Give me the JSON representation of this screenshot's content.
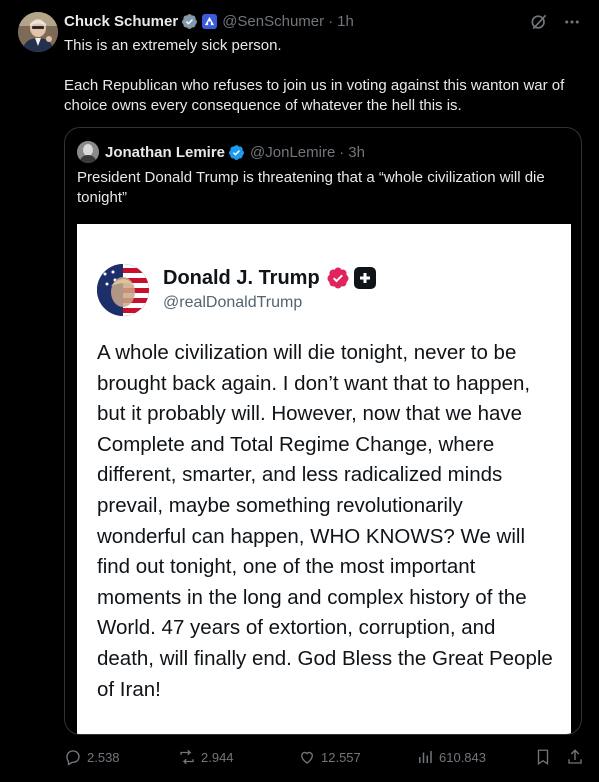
{
  "author": {
    "name": "Chuck Schumer",
    "handle": "@SenSchumer",
    "time": "1h"
  },
  "separator": "·",
  "body": {
    "line1": "This is an extremely sick person.",
    "line2": "Each Republican who refuses to join us in voting against this wanton war of choice owns every consequence of whatever the hell this is."
  },
  "quote": {
    "name": "Jonathan Lemire",
    "handle": "@JonLemire",
    "time": "3h",
    "text": "President Donald Trump is threatening that a “whole civilization will die tonight”",
    "card": {
      "name": "Donald J. Trump",
      "handle": "@realDonaldTrump",
      "text": "A whole civilization will die tonight, never to be brought back again. I don’t want that to happen, but it probably will. However, now that we have Complete and Total Regime Change, where different, smarter, and less radicalized minds prevail, maybe something revolutionarily wonderful can happen, WHO KNOWS? We will find out tonight, one of the most important moments in the long and complex history of the World. 47 years of extortion, corruption, and death, will finally end. God Bless the Great People of Iran!"
    }
  },
  "actions": {
    "replies": "2.538",
    "reposts": "2.944",
    "likes": "12.557",
    "views": "610.843"
  },
  "icons": {
    "verified": "verified-badge-icon",
    "government": "government-badge-icon",
    "grok": "grok-icon",
    "more": "more-icon",
    "reply": "reply-icon",
    "repost": "repost-icon",
    "like": "like-icon",
    "views": "views-icon",
    "bookmark": "bookmark-icon",
    "share": "share-icon"
  },
  "colors": {
    "background": "#000000",
    "text": "#e7e9ea",
    "secondary": "#71767b",
    "verified": "#1d9bf0",
    "border": "#2f3336",
    "card_background": "#ffffff",
    "card_badge": "#e0245e"
  }
}
